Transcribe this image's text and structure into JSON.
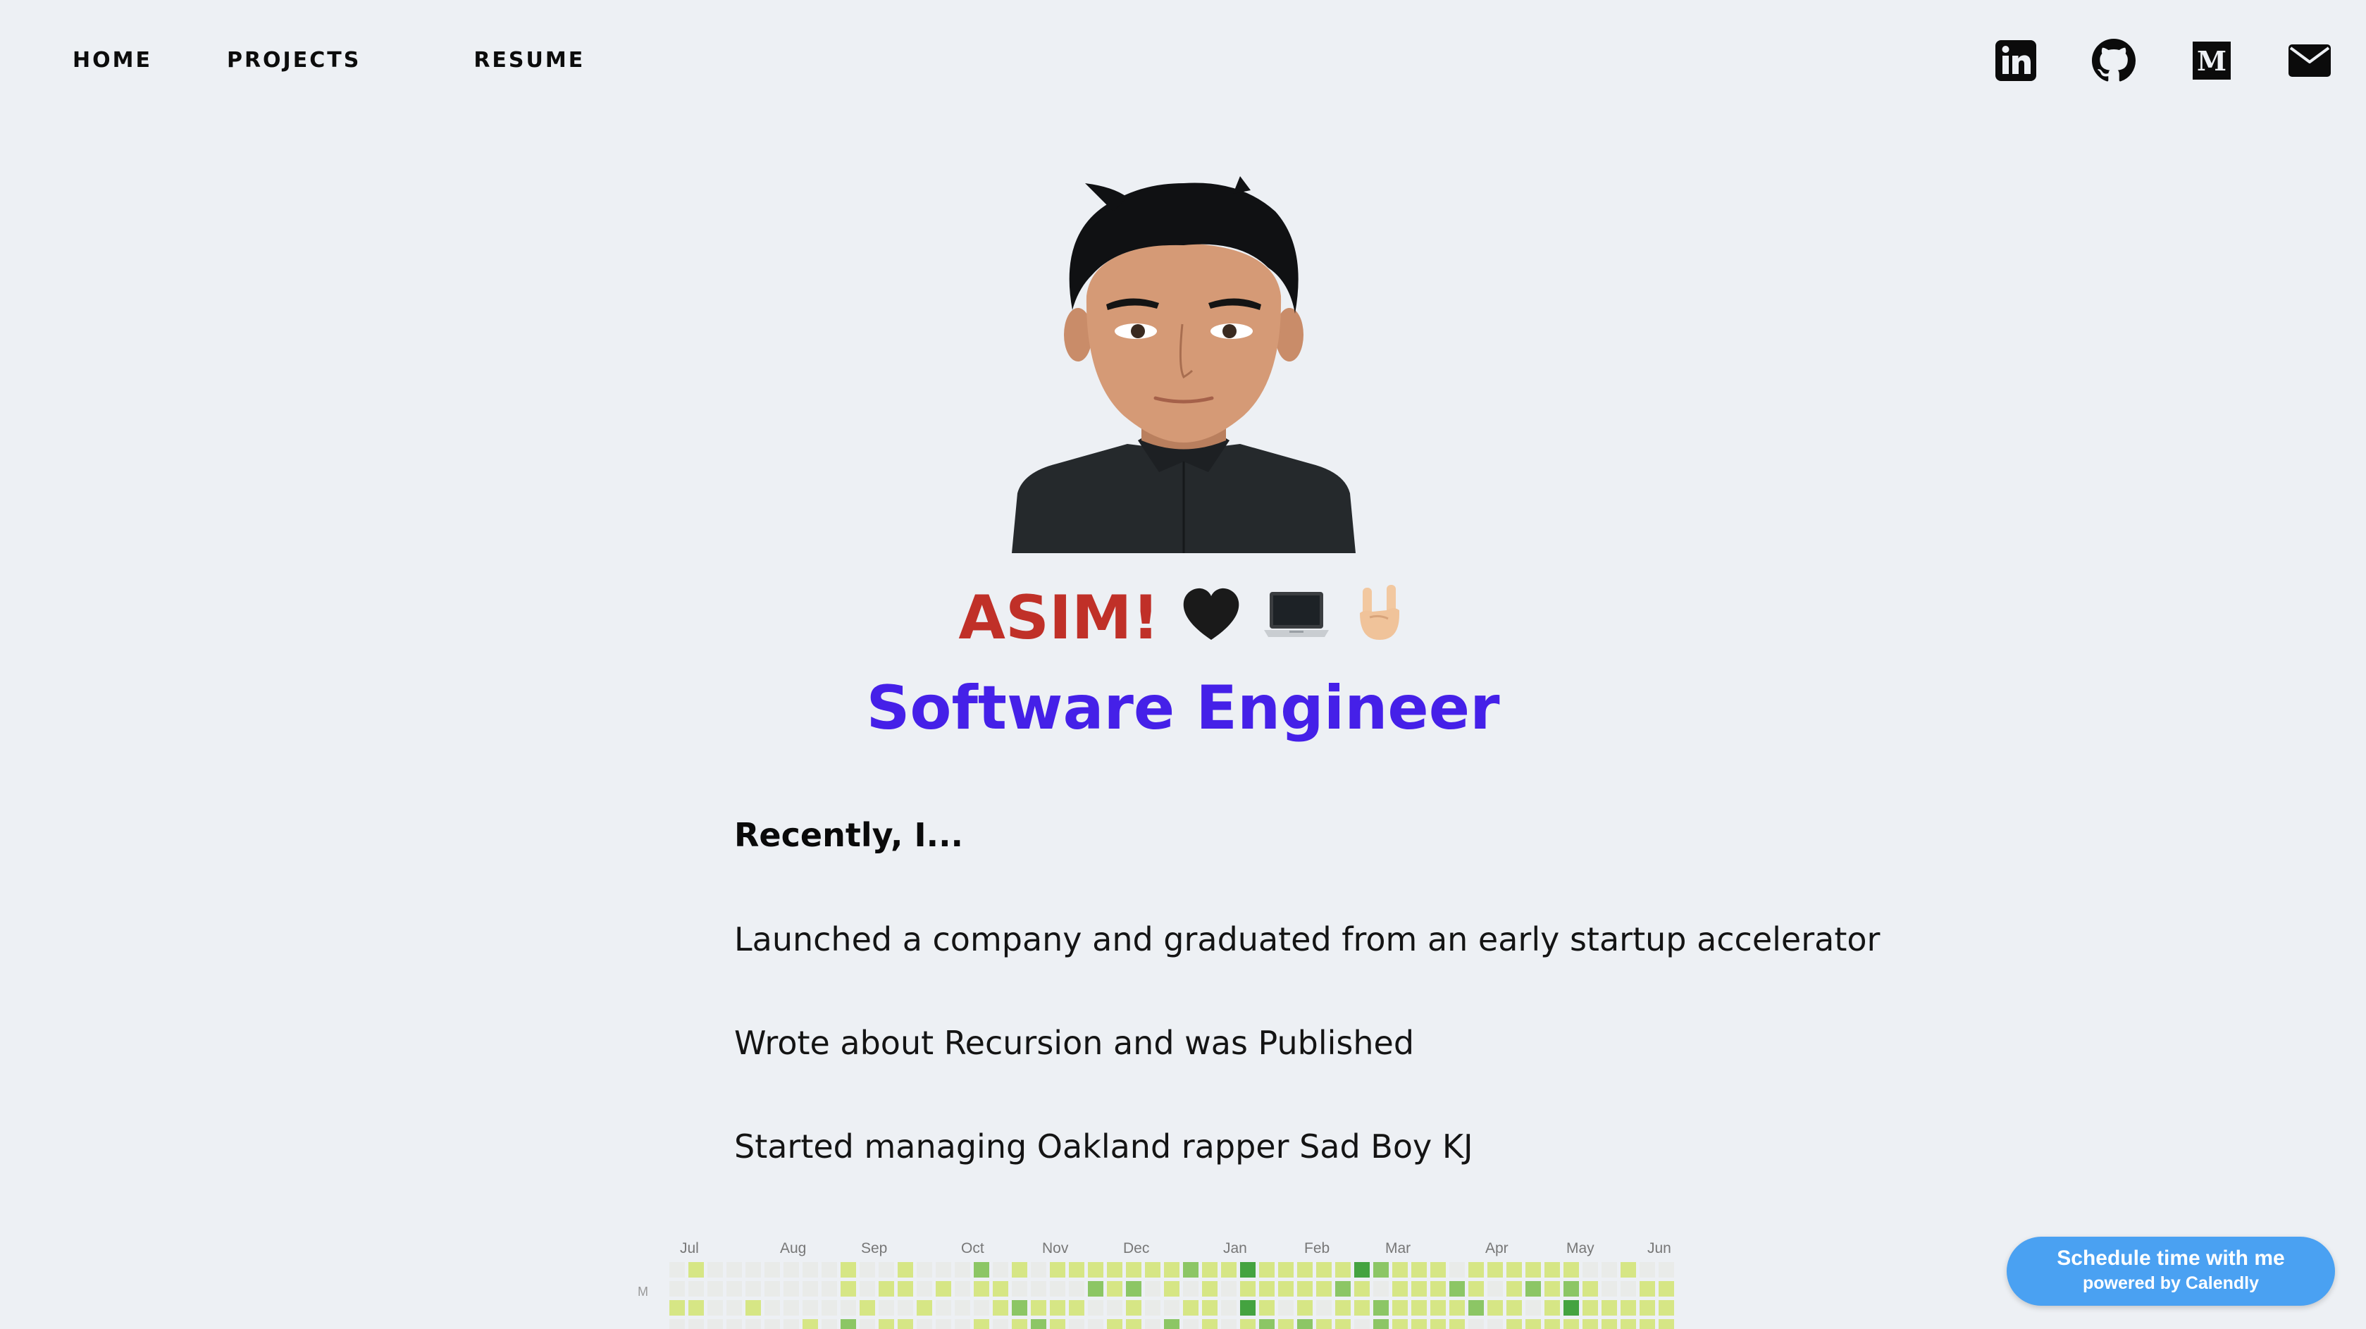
{
  "nav": {
    "home": "HOME",
    "projects": "PROJECTS",
    "resume": "RESUME"
  },
  "social": {
    "icons": [
      "linkedin-icon",
      "github-icon",
      "medium-icon",
      "mail-icon"
    ],
    "medium_letter": "M"
  },
  "hero": {
    "name": "ASIM!",
    "emojis": [
      "black-heart",
      "laptop",
      "sign-of-the-horns"
    ],
    "role": "Software Engineer"
  },
  "recently": {
    "heading": "Recently, I...",
    "items": [
      "Launched a company and graduated from an early startup accelerator",
      "Wrote about Recursion and was Published",
      "Started managing Oakland rapper Sad Boy KJ"
    ]
  },
  "contributions": {
    "months": [
      "Jul",
      "Aug",
      "Sep",
      "Oct",
      "Nov",
      "Dec",
      "Jan",
      "Feb",
      "Mar",
      "Apr",
      "May",
      "Jun"
    ],
    "day_label": "M",
    "colors": [
      "#ebedf0",
      "#d6e685",
      "#8cc665",
      "#44a340",
      "#1e6823"
    ]
  },
  "calendly": {
    "line1": "Schedule time with me",
    "line2": "powered by Calendly",
    "color": "#4aa1f2"
  },
  "colors": {
    "background": "#edf0f4",
    "name": "#c03028",
    "role": "#4520e8"
  }
}
